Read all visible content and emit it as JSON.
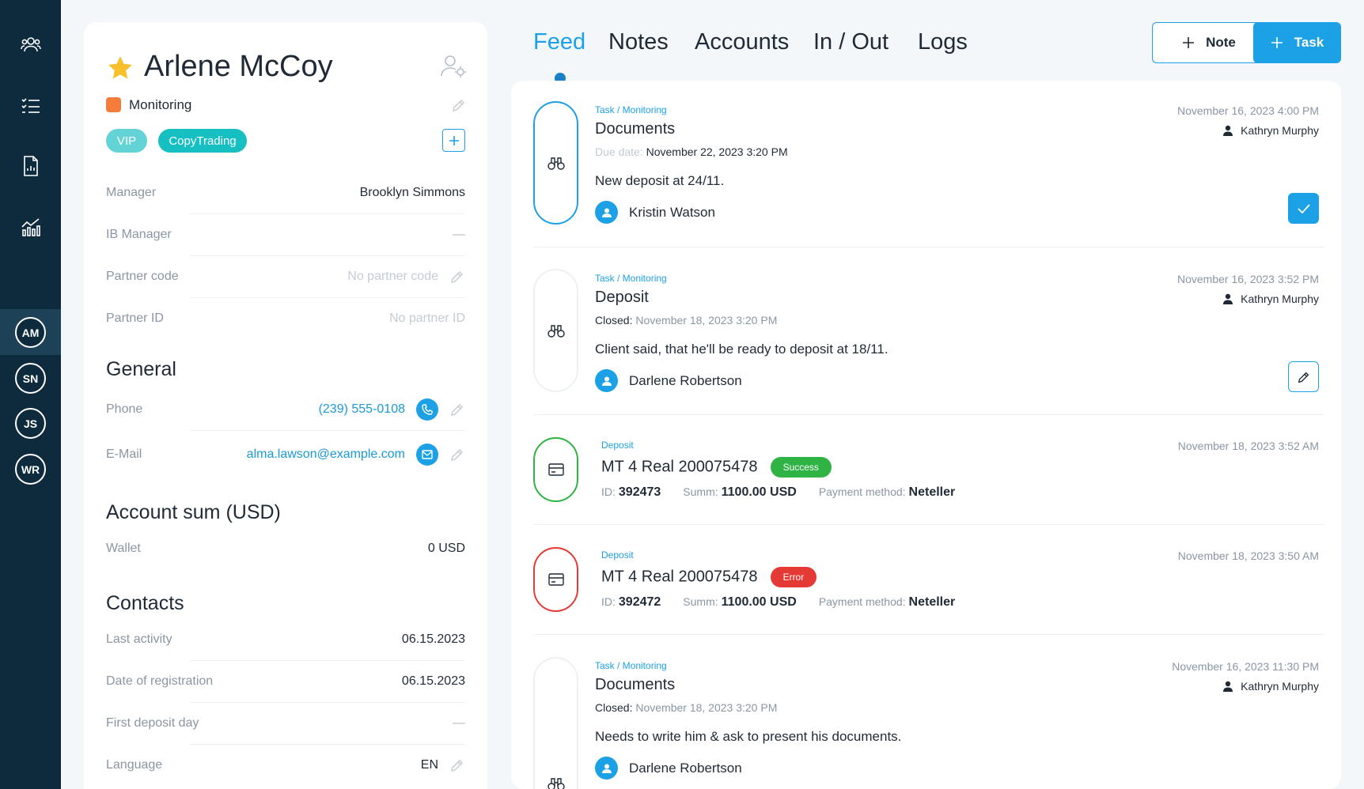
{
  "sidebar": {
    "nav": [
      {
        "icon": "users-icon"
      },
      {
        "icon": "checklist-icon"
      },
      {
        "icon": "document-chart-icon"
      },
      {
        "icon": "analytics-icon"
      }
    ],
    "avatars": [
      "AM",
      "SN",
      "JS",
      "WR"
    ]
  },
  "profile": {
    "name": "Arlene McCoy",
    "status": "Monitoring",
    "status_color": "#f57c3b",
    "tags": [
      "VIP",
      "CopyTrading"
    ],
    "fields": {
      "manager": {
        "label": "Manager",
        "value": "Brooklyn Simmons"
      },
      "ib_manager": {
        "label": "IB Manager",
        "value": ""
      },
      "partner_code": {
        "label": "Partner code",
        "value": "No partner code"
      },
      "partner_id": {
        "label": "Partner ID",
        "value": "No partner ID"
      }
    },
    "general": {
      "title": "General",
      "phone": {
        "label": "Phone",
        "value": "(239) 555-0108"
      },
      "email": {
        "label": "E-Mail",
        "value": "alma.lawson@example.com"
      }
    },
    "account_sum": {
      "title": "Account sum (USD)",
      "wallet": {
        "label": "Wallet",
        "value": "0 USD"
      }
    },
    "contacts": {
      "title": "Contacts",
      "last_activity": {
        "label": "Last activity",
        "value": "06.15.2023"
      },
      "registration": {
        "label": "Date of registration",
        "value": "06.15.2023"
      },
      "first_deposit": {
        "label": "First deposit day",
        "value": ""
      },
      "language": {
        "label": "Language",
        "value": "EN"
      }
    }
  },
  "tabs": [
    "Feed",
    "Notes",
    "Accounts",
    "In / Out",
    "Logs"
  ],
  "active_tab": "Feed",
  "actions": {
    "note": "Note",
    "task": "Task"
  },
  "feed": [
    {
      "type": "task",
      "crumb": "Task / Monitoring",
      "title": "Documents",
      "sub_key": "Due date:",
      "sub_value": "November 22, 2023 3:20 PM",
      "body": "New deposit at 24/11.",
      "assignee": "Kristin Watson",
      "date": "November 16, 2023 4:00 PM",
      "author": "Kathryn Murphy",
      "border_color": "#1da1e6"
    },
    {
      "type": "task",
      "crumb": "Task / Monitoring",
      "title": "Deposit",
      "sub_key": "Closed:",
      "sub_value": "November 18, 2023 3:20 PM",
      "body": "Client said, that he'll be ready to deposit at 18/11.",
      "assignee": "Darlene Robertson",
      "date": "November 16, 2023 3:52 PM",
      "author": "Kathryn Murphy",
      "border_color": "#eef1f4"
    },
    {
      "type": "deposit",
      "crumb": "Deposit",
      "title": "MT 4 Real 200075478",
      "badge": "Success",
      "id_label": "ID:",
      "id": "392473",
      "summ_label": "Summ:",
      "summ": "1100.00 USD",
      "method_label": "Payment method:",
      "method": "Neteller",
      "date": "November 18, 2023 3:52 AM",
      "border_color": "#2fb344"
    },
    {
      "type": "deposit",
      "crumb": "Deposit",
      "title": "MT 4 Real 200075478",
      "badge": "Error",
      "id_label": "ID:",
      "id": "392472",
      "summ_label": "Summ:",
      "summ": "1100.00 USD",
      "method_label": "Payment method:",
      "method": "Neteller",
      "date": "November 18, 2023 3:50 AM",
      "border_color": "#e53935"
    },
    {
      "type": "task",
      "crumb": "Task / Monitoring",
      "title": "Documents",
      "sub_key": "Closed:",
      "sub_value": "November 18, 2023 3:20 PM",
      "body": "Needs to write him & ask to present his documents.",
      "assignee": "Darlene Robertson",
      "date": "November 16, 2023 11:30 PM",
      "author": "Kathryn Murphy",
      "border_color": "#eef1f4"
    }
  ]
}
